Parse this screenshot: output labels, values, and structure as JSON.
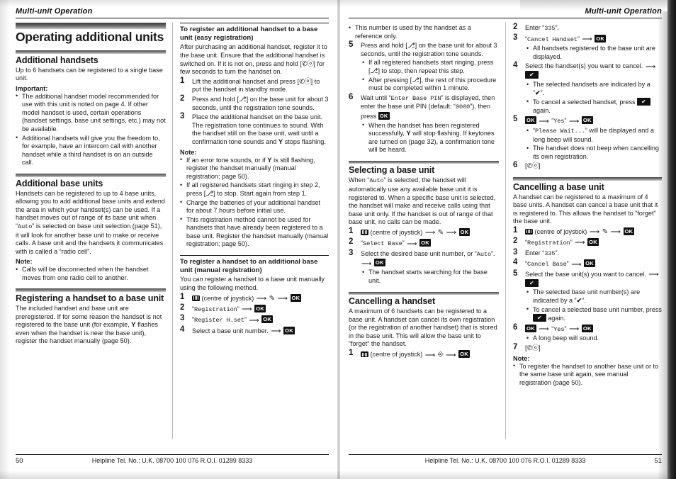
{
  "document": {
    "running_head_left": "Multi-unit Operation",
    "running_head_right": "Multi-unit Operation"
  },
  "icons": {
    "joystick": "joystick-centre-icon",
    "ok_key": "OK",
    "check_key": "✔",
    "antenna": "Υ",
    "offhook": "✆ⓞ",
    "page_book": "⎇",
    "eraser": "✎",
    "arrow": "⟶",
    "bullet": "•",
    "checkmark": "✔"
  },
  "left_page": {
    "folio": "50",
    "helpline": "Helpline Tel. No.: U.K. 08700 100 076  R.O.I. 01289 8333",
    "column1": {
      "chapter_title": "Operating additional units",
      "section1": {
        "title": "Additional handsets",
        "intro": "Up to 6 handsets can be registered to a single base unit.",
        "important_label": "Important:",
        "important_bullets": [
          "The additional handset model recommended for use with this unit is noted on page 4. If other model handset is used, certain operations (handset settings, base unit settings, etc.) may not be available.",
          "Additional handsets will give you the freedom to, for example, have an intercom call with another handset while a third handset is on an outside call."
        ]
      },
      "section2": {
        "title": "Additional base units",
        "body_part1": "Handsets can be registered to up to 4 base units, allowing you to add additional base units and extend the area in which your handset(s) can be used. If a handset moves out of range of its base unit when “",
        "body_auto": "Auto",
        "body_part2": "” is selected on base unit selection (page 51), it will look for another base unit to make or receive calls. A base unit and the handsets it communicates with is called a “radio cell”.",
        "note_label": "Note:",
        "note_bullets": [
          "Calls will be disconnected when the handset moves from one radio cell to another."
        ]
      },
      "section3": {
        "title": "Registering a handset to a base unit",
        "body_part1": "The included handset and base unit are preregistered. If for some reason the handset is not registered to the base unit (for example, ",
        "body_part2": " flashes even when the handset is near the base unit), register the handset manually (page 50)."
      }
    },
    "column2": {
      "sub1": {
        "title": "To register an additional handset to a base unit (easy registration)",
        "intro_part1": "After purchasing an additional handset, register it to the base unit. Ensure that the additional handset is switched on. If it is not on, press and hold [",
        "intro_part2": "] for few seconds to turn the handset on.",
        "steps": [
          {
            "num": "1",
            "text_part1": "Lift the additional handset and press [",
            "text_part2": "] to put the handset in standby mode."
          },
          {
            "num": "2",
            "text_part1": "Press and hold [",
            "text_part2": "] on the base unit for about 3 seconds, until the registration tone sounds."
          },
          {
            "num": "3",
            "text_part1": "Place the additional handset on the base unit. The registration tone continues to sound. With the handset still on the base unit, wait until a confirmation tone sounds and ",
            "text_part2": " stops flashing."
          }
        ],
        "note_label": "Note:",
        "note_bullets": [
          {
            "part1": "If an error tone sounds, or if ",
            "part2": " is still flashing, register the handset manually (manual registration; page 50)."
          },
          {
            "part1": "If all registered handsets start ringing in step 2, press [",
            "part2": "] to stop. Start again from step 1."
          },
          {
            "part1": "Charge the batteries of your additional handset for about 7 hours before initial use.",
            "part2": ""
          },
          {
            "part1": "This registration method cannot be used for handsets that have already been registered to a base unit. Register the handset manually (manual registration; page 50).",
            "part2": ""
          }
        ]
      },
      "sub2": {
        "title": "To register a handset to an additional base unit (manual registration)",
        "intro": "You can register a handset to a base unit manually using the following method.",
        "steps": [
          {
            "num": "1",
            "text": "(centre of joystick)"
          },
          {
            "num": "2",
            "lcd": "Registration"
          },
          {
            "num": "3",
            "lcd": "Register H.set"
          },
          {
            "num": "4",
            "text": "Select a base unit number."
          }
        ]
      }
    }
  },
  "right_page": {
    "folio": "51",
    "helpline": "Helpline Tel. No.: U.K. 08700 100 076  R.O.I. 01289 8333",
    "column1": {
      "lead_bullets": [
        "This number is used by the handset as a reference only."
      ],
      "steps": [
        {
          "num": "5",
          "text_part1": "Press and hold [",
          "text_part2": "] on the base unit for about 3 seconds, until the registration tone sounds.",
          "bullets": [
            {
              "part1": "If all registered handsets start ringing, press [",
              "part2": "] to stop, then repeat this step."
            },
            {
              "part1": "After pressing [",
              "part2": "], the rest of this procedure must be completed within 1 minute."
            }
          ]
        },
        {
          "num": "6",
          "text_part1": "Wait until “",
          "lcd": "Enter Base PIN",
          "text_part2": "” is displayed, then enter the base unit PIN (default: “",
          "lcd2": "0000",
          "text_part3": "”), then press ",
          "text_part4": ".",
          "bullets": [
            {
              "part1": "When the handset has been registered successfully, ",
              "part2": " will stop flashing. If keytones are turned on (page 32), a confirmation tone will be heard."
            }
          ]
        }
      ],
      "section_select": {
        "title": "Selecting a base unit",
        "body_part1": "When “",
        "body_auto": "Auto",
        "body_part2": "” is selected, the handset will automatically use any available base unit it is registered to. When a specific base unit is selected, the handset will make and receive calls using that base unit only. If the handset is out of range of that base unit, no calls can be made.",
        "steps": [
          {
            "num": "1",
            "text": "(centre of joystick)"
          },
          {
            "num": "2",
            "lcd": "Select Base"
          },
          {
            "num": "3",
            "text_part1": "Select the desired base unit number, or “",
            "lcd": "Auto",
            "text_part2": "”.",
            "bullets": [
              "The handset starts searching for the base unit."
            ]
          }
        ]
      },
      "section_cancel_handset": {
        "title": "Cancelling a handset",
        "body": "A maximum of 6 handsets can be registered to a base unit. A handset can cancel its own registration (or the registration of another handset) that is stored in the base unit. This will allow the base unit to “forget” the handset.",
        "step1": {
          "num": "1",
          "text": "(centre of joystick)"
        }
      }
    },
    "column2": {
      "steps": [
        {
          "num": "2",
          "text_part1": "Enter “",
          "lcd": "335",
          "text_part2": "”."
        },
        {
          "num": "3",
          "lcd": "Cancel Handset",
          "bullets": [
            "All handsets registered to the base unit are displayed."
          ]
        },
        {
          "num": "4",
          "text": "Select the handset(s) you want to cancel.",
          "bullets": [
            {
              "part1": "The selected handsets are indicated by a “",
              "part2": "”."
            },
            {
              "part1": "To cancel a selected handset, press ",
              "part2": " again."
            }
          ]
        },
        {
          "num": "5",
          "yes": "Yes",
          "bullets": [
            {
              "part1": "“",
              "lcd": "Please Wait...",
              "part2": "” will be displayed and a long beep will sound."
            },
            {
              "part1": "The handset does not beep when cancelling its own registration.",
              "part2": ""
            }
          ]
        },
        {
          "num": "6",
          "key": "offhook"
        }
      ],
      "section_cancel_base": {
        "title": "Cancelling a base unit",
        "body": "A handset can be registered to a maximum of 4 base units. A handset can cancel a base unit that it is registered to. This allows the handset to “forget” the base unit.",
        "steps": [
          {
            "num": "1",
            "text": "(centre of joystick)"
          },
          {
            "num": "2",
            "lcd": "Registration"
          },
          {
            "num": "3",
            "text_part1": "Enter “",
            "lcd": "335",
            "text_part2": "”."
          },
          {
            "num": "4",
            "lcd": "Cancel Base"
          },
          {
            "num": "5",
            "text": "Select the base unit(s) you want to cancel.",
            "bullets": [
              {
                "part1": "The selected base unit number(s) are indicated by a “",
                "part2": "”."
              },
              {
                "part1": "To cancel a selected base unit number, press ",
                "part2": " again."
              }
            ]
          },
          {
            "num": "6",
            "yes": "Yes",
            "bullets": [
              "A long beep will sound."
            ]
          },
          {
            "num": "7",
            "key": "offhook"
          }
        ],
        "note_label": "Note:",
        "note_bullets": [
          "To register the handset to another base unit or to the same base unit again, see manual registration (page 50)."
        ]
      }
    }
  }
}
